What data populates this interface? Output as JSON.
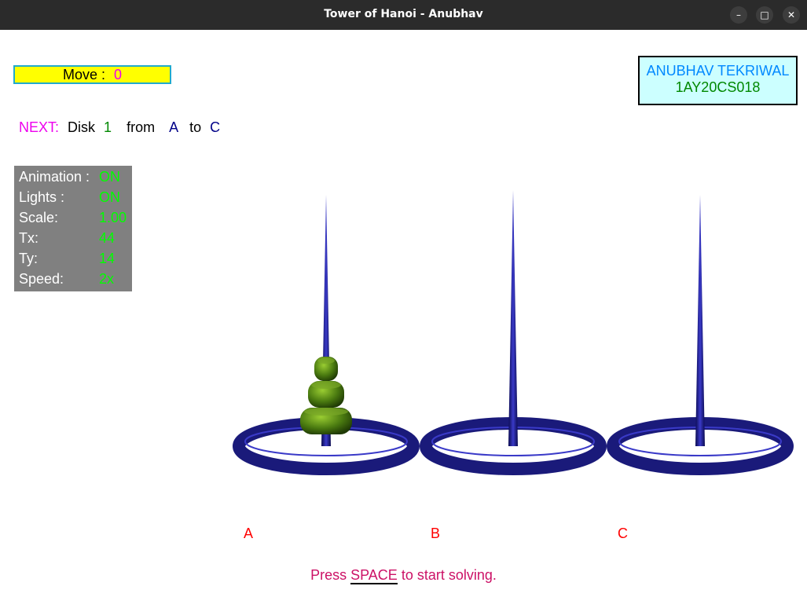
{
  "window": {
    "title": "Tower of Hanoi - Anubhav",
    "minimize_glyph": "–",
    "maximize_glyph": "□",
    "close_glyph": "✕"
  },
  "move": {
    "label": "Move :",
    "value": "0"
  },
  "author": {
    "name": "ANUBHAV TEKRIWAL",
    "id": "1AY20CS018"
  },
  "next": {
    "prefix": "NEXT:",
    "disk_word": "Disk",
    "disk": "1",
    "from_word": "from",
    "from": "A",
    "to_word": "to",
    "to": "C"
  },
  "status": [
    {
      "label": "Animation :",
      "value": "ON"
    },
    {
      "label": "Lights :",
      "value": "ON"
    },
    {
      "label": "Scale:",
      "value": "1.00"
    },
    {
      "label": "Tx:",
      "value": "44"
    },
    {
      "label": "Ty:",
      "value": "14"
    },
    {
      "label": "Speed:",
      "value": "2x"
    }
  ],
  "pegs": {
    "a": "A",
    "b": "B",
    "c": "C"
  },
  "disks_on_peg_a": 3,
  "footer": {
    "before": "Press",
    "key": "SPACE",
    "after": "to start solving."
  },
  "colors": {
    "peg": "#1a1a7a",
    "disk": "#4a7a10",
    "move_bg": "#ffff00",
    "name_bg": "#ccffff",
    "panel_bg": "#808080",
    "status_value": "#00ff00",
    "next_prefix": "#ee00ee",
    "peg_label": "#ff0000",
    "footer_text": "#cc1166"
  }
}
